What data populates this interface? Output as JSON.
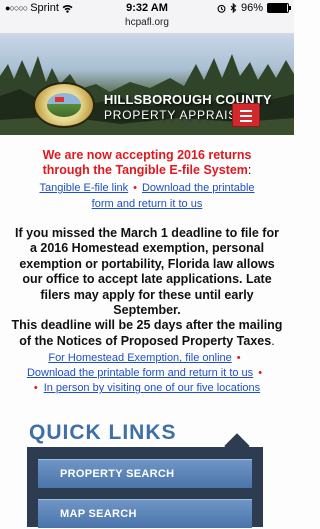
{
  "status_bar": {
    "carrier": "Sprint",
    "time": "9:32 AM",
    "battery_text": "96%",
    "battery_level": 0.96,
    "signal_dots": "●○○○○",
    "wifi_icon": "wifi-icon",
    "alarm_icon": "alarm-icon",
    "bluetooth_icon": "bluetooth-icon"
  },
  "browser": {
    "url": "hcpafl.org"
  },
  "header": {
    "line1": "HILLSBOROUGH COUNTY",
    "line2": "PROPERTY APPRAISER",
    "menu_icon": "hamburger-menu-icon"
  },
  "notice": {
    "line1": "We are now accepting 2016 returns",
    "line2": "through the Tangible E-file System",
    "colon": ":",
    "link_efile": "Tangible E-file link",
    "link_download_1": "Download the printable",
    "link_download_2": "form and return it to us"
  },
  "paragraph": {
    "text1": "If you missed the March 1 deadline to file for a 2016 Homestead exemption, personal exemption or portability, Florida law allows our office to accept late applications. Late filers may apply for these until early September.",
    "text2": "This deadline will be 25 days after the mailing of the Notices of Proposed Property Taxes",
    "period": "."
  },
  "homestead_links": {
    "link_online": "For Homestead Exemption, file online",
    "link_printable": "Download the printable form and return it to us",
    "link_person": "In person by visiting one of our five locations"
  },
  "quick_links": {
    "title": "QUICK LINKS",
    "buttons": [
      "PROPERTY SEARCH",
      "MAP SEARCH"
    ]
  },
  "colors": {
    "accent_red": "#e0191f",
    "link_blue": "#1f4fc7",
    "quick_links_title": "#3e6fa6",
    "panel_dark": "#2e3c52",
    "button_blue": "#4a74ab"
  }
}
